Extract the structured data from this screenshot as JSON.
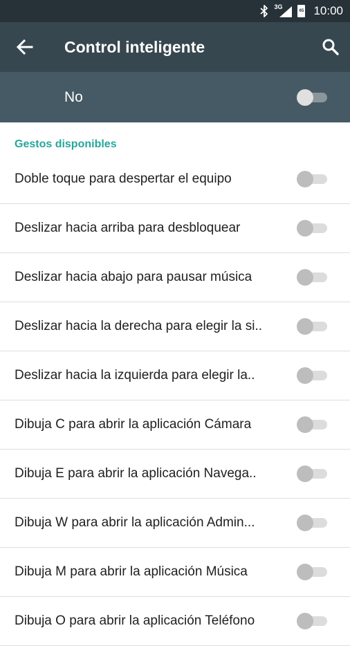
{
  "status_bar": {
    "network_label": "3G",
    "battery_label": "65",
    "time": "10:00"
  },
  "toolbar": {
    "title": "Control inteligente",
    "back_icon": "arrow-back-icon",
    "search_icon": "search-icon"
  },
  "master_switch": {
    "label": "No",
    "state": "off"
  },
  "section": {
    "header": "Gestos disponibles"
  },
  "gestures": [
    {
      "label": "Doble toque para despertar el equipo",
      "state": "off"
    },
    {
      "label": "Deslizar hacia arriba para desbloquear",
      "state": "off"
    },
    {
      "label": "Deslizar hacia abajo para pausar música",
      "state": "off"
    },
    {
      "label": "Deslizar hacia la derecha para elegir la si..",
      "state": "off"
    },
    {
      "label": "Deslizar hacia la izquierda para elegir la..",
      "state": "off"
    },
    {
      "label": "Dibuja C para abrir la aplicación Cámara",
      "state": "off"
    },
    {
      "label": "Dibuja E para abrir la aplicación Navega..",
      "state": "off"
    },
    {
      "label": "Dibuja W para abrir la aplicación Admin...",
      "state": "off"
    },
    {
      "label": "Dibuja M para abrir la aplicación Música",
      "state": "off"
    },
    {
      "label": "Dibuja O para abrir la aplicación Teléfono",
      "state": "off"
    }
  ],
  "colors": {
    "status_bar": "#263238",
    "toolbar": "#37474F",
    "master_bar": "#455A64",
    "accent": "#26A69A"
  }
}
